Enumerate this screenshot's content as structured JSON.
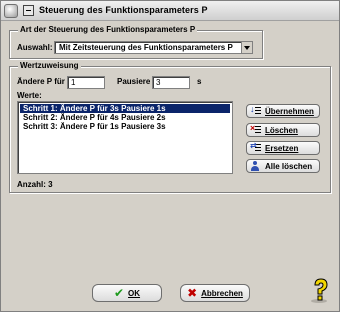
{
  "window": {
    "title": "Steuerung des Funktionsparameters P"
  },
  "group_art": {
    "title": "Art der Steuerung des Funktionsparameters P",
    "auswahl_label": "Auswahl:",
    "auswahl_value": "Mit Zeitsteuerung des Funktionsparameters P"
  },
  "group_wert": {
    "title": "Wertzuweisung",
    "aendere_label": "Ändere P für",
    "aendere_value": "1",
    "pausiere_label": "Pausiere",
    "pausiere_value": "3",
    "unit": "s",
    "werte_label": "Werte:",
    "items": [
      {
        "text": "Schritt 1:  Ändere P für 3s  Pausiere 1s",
        "selected": true
      },
      {
        "text": "Schritt 2:  Ändere P für 4s  Pausiere 2s",
        "selected": false
      },
      {
        "text": "Schritt 3:  Ändere P für 1s  Pausiere 3s",
        "selected": false
      }
    ],
    "anzahl": "Anzahl: 3"
  },
  "side_buttons": {
    "uebernehmen": "Übernehmen",
    "loeschen": "Löschen",
    "ersetzen": "Ersetzen",
    "alle_loeschen": "Alle löschen"
  },
  "footer": {
    "ok": "OK",
    "cancel": "Abbrechen"
  },
  "colors": {
    "selection": "#0a246a",
    "dialog_face": "#d4d0c8",
    "ok_check": "#1e9a1e",
    "cancel_x": "#c00000",
    "help_question": "#f2d600"
  },
  "icons": {
    "uebernehmen": "insert-list-icon",
    "loeschen": "delete-list-icon",
    "ersetzen": "replace-list-icon",
    "alle_loeschen": "users-icon",
    "help": "help-question-icon"
  }
}
